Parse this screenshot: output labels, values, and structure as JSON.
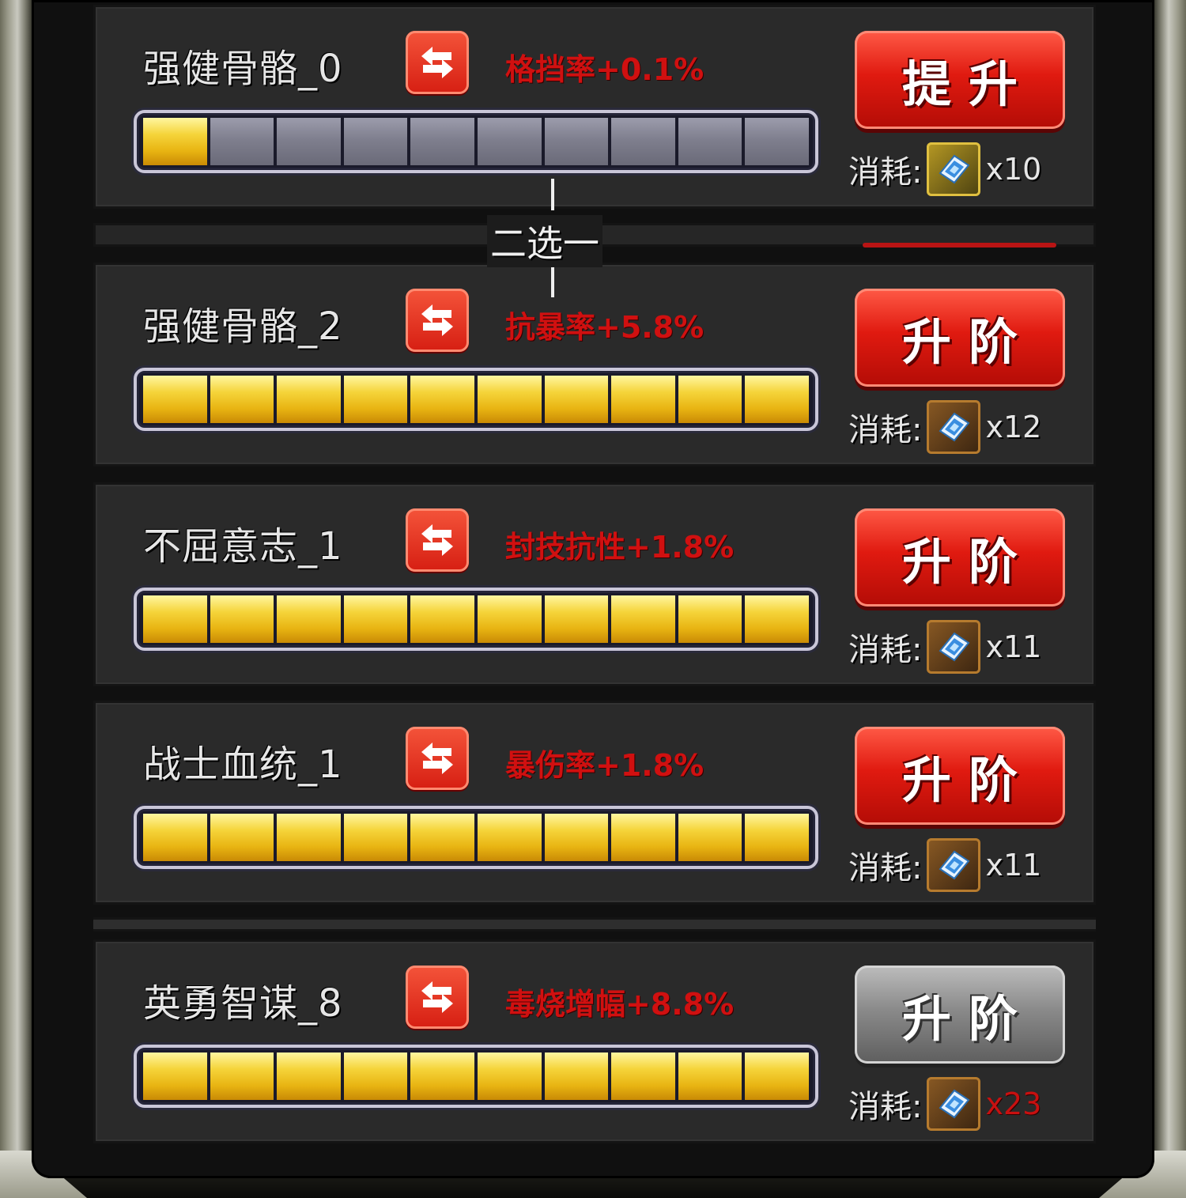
{
  "choose_label": "二选一",
  "cost_label": "消耗:",
  "colors": {
    "attr_text": "#d01010",
    "bar_filled": "#f5d43a",
    "bar_empty": "#7f7f8e",
    "button_red": "#e01a10",
    "button_disabled": "#8a8a8a"
  },
  "icons": {
    "swap": "swap-arrows-icon",
    "item": "upgrade-book-icon"
  },
  "rows": [
    {
      "name": "强健骨骼_0",
      "attribute": "格挡率+0.1%",
      "progress_filled": 1,
      "progress_total": 10,
      "button_label": "提升",
      "button_enabled": true,
      "cost_qty": "x10",
      "cost_sufficient": true
    },
    {
      "name": "强健骨骼_2",
      "attribute": "抗暴率+5.8%",
      "progress_filled": 10,
      "progress_total": 10,
      "button_label": "升阶",
      "button_enabled": true,
      "cost_qty": "x12",
      "cost_sufficient": true
    },
    {
      "name": "不屈意志_1",
      "attribute": "封技抗性+1.8%",
      "progress_filled": 10,
      "progress_total": 10,
      "button_label": "升阶",
      "button_enabled": true,
      "cost_qty": "x11",
      "cost_sufficient": true
    },
    {
      "name": "战士血统_1",
      "attribute": "暴伤率+1.8%",
      "progress_filled": 10,
      "progress_total": 10,
      "button_label": "升阶",
      "button_enabled": true,
      "cost_qty": "x11",
      "cost_sufficient": true
    },
    {
      "name": "英勇智谋_8",
      "attribute": "毒烧增幅+8.8%",
      "progress_filled": 10,
      "progress_total": 10,
      "button_label": "升阶",
      "button_enabled": false,
      "cost_qty": "x23",
      "cost_sufficient": false
    }
  ]
}
